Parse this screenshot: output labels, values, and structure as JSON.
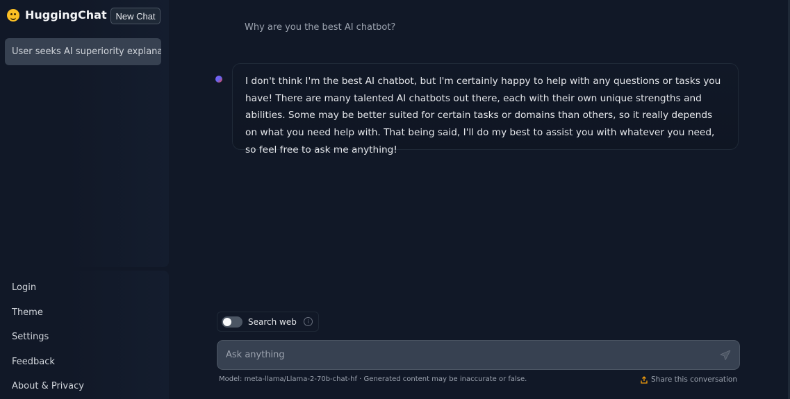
{
  "brand": {
    "name": "HuggingChat",
    "logo_icon": "smiling-face-logo"
  },
  "sidebar": {
    "new_chat_label": "New Chat",
    "conversations": [
      {
        "title": "User seeks AI superiority explanat..."
      }
    ],
    "nav": [
      {
        "label": "Login"
      },
      {
        "label": "Theme"
      },
      {
        "label": "Settings"
      },
      {
        "label": "Feedback"
      },
      {
        "label": "About & Privacy"
      }
    ]
  },
  "chat": {
    "user_message": "Why are you the best AI chatbot?",
    "assistant_message": "I don't think I'm the best AI chatbot, but I'm certainly happy to help with any questions or tasks you have! There are many talented AI chatbots out there, each with their own unique strengths and abilities. Some may be better suited for certain tasks or domains than others, so it really depends on what you need help with. That being said, I'll do my best to assist you with whatever you need, so feel free to ask me anything!"
  },
  "composer": {
    "search_web_label": "Search web",
    "search_web_enabled": false,
    "placeholder": "Ask anything",
    "value": ""
  },
  "footer": {
    "model_note": "Model: meta-llama/Llama-2-70b-chat-hf · Generated content may be inaccurate or false.",
    "share_label": "Share this conversation"
  },
  "colors": {
    "background": "#111827",
    "input_bg": "#374151",
    "share_icon": "#f59e0b"
  }
}
